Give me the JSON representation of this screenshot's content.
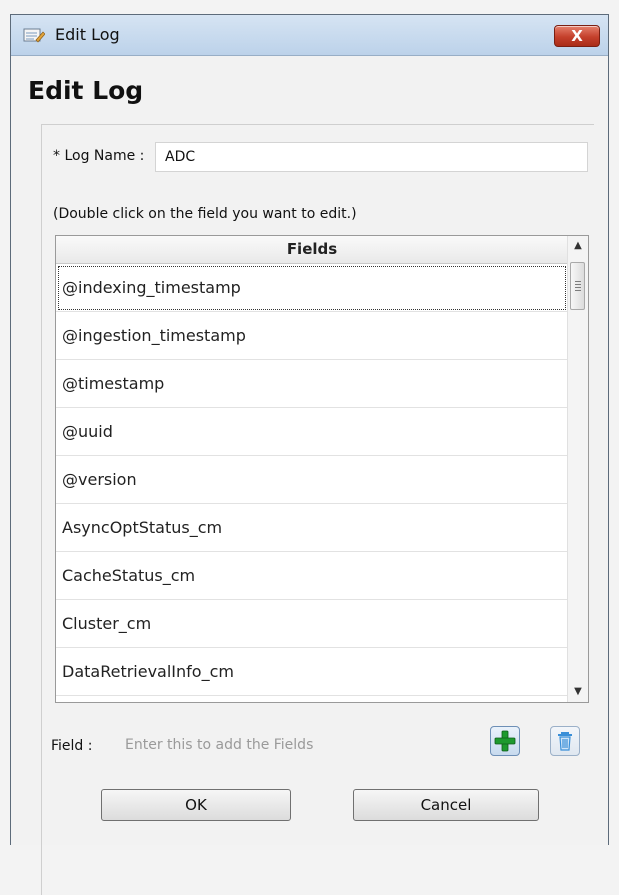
{
  "window": {
    "title": "Edit Log",
    "close_symbol": "X",
    "app_icon": "edit-log-icon"
  },
  "heading": "Edit Log",
  "log_name": {
    "label": "* Log Name :",
    "value": "ADC"
  },
  "hint": "(Double click on the field you want to edit.)",
  "fields_table": {
    "header": "Fields",
    "rows": [
      "@indexing_timestamp",
      "@ingestion_timestamp",
      "@timestamp",
      "@uuid",
      "@version",
      "AsyncOptStatus_cm",
      "CacheStatus_cm",
      "Cluster_cm",
      "DataRetrievalInfo_cm"
    ],
    "selected_index": 0
  },
  "field_entry": {
    "label": "Field :",
    "placeholder": "Enter this to add the Fields",
    "value": ""
  },
  "buttons": {
    "add_icon": "plus-icon",
    "delete_icon": "trash-icon",
    "ok": "OK",
    "cancel": "Cancel"
  },
  "colors": {
    "close_button": "#c4402b",
    "add_icon": "#1e9a2e",
    "delete_icon": "#3a8fd8",
    "titlebar": "#bcd2ea"
  }
}
